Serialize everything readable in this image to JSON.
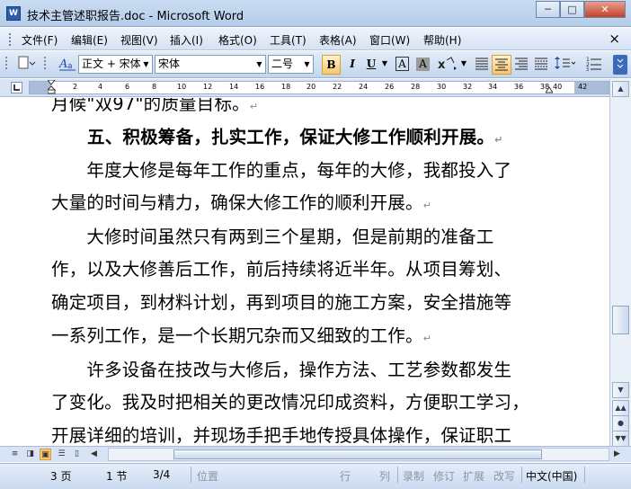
{
  "window": {
    "title": "技术主管述职报告.doc - Microsoft Word",
    "app_icon": "W",
    "controls": {
      "minimize": "─",
      "maximize": "□",
      "close": "✕"
    }
  },
  "menu": {
    "items": [
      "文件(F)",
      "编辑(E)",
      "视图(V)",
      "插入(I)",
      "格式(O)",
      "工具(T)",
      "表格(A)",
      "窗口(W)",
      "帮助(H)"
    ],
    "close_doc": "×"
  },
  "toolbar": {
    "style_value": "正文 + 宋体",
    "font_value": "宋体",
    "size_value": "二号",
    "bold": "B",
    "italic": "I",
    "underline": "U",
    "char_border": "A",
    "char_shading": "A",
    "font_color": "A",
    "highlight_color": "#f0c050",
    "accent": "#f7c56b"
  },
  "ruler": {
    "ticks": [
      "2",
      "4",
      "6",
      "8",
      "10",
      "12",
      "14",
      "16",
      "18",
      "20",
      "22",
      "24",
      "26",
      "28",
      "30",
      "32",
      "34",
      "36",
      "38",
      "40",
      "42"
    ]
  },
  "document": {
    "partial_line": "月候\"双97\"的质量目标。",
    "heading": "五、积极筹备，扎实工作，保证大修工作顺利开展。",
    "lines": [
      "　　年度大修是每年工作的重点，每年的大修，我都投入了",
      "大量的时间与精力，确保大修工作的顺利开展。",
      "　　大修时间虽然只有两到三个星期，但是前期的准备工",
      "作，以及大修善后工作，前后持续将近半年。从项目筹划、",
      "确定项目，到材料计划，再到项目的施工方案，安全措施等",
      "一系列工作，是一个长期冗杂而又细致的工作。",
      "　　许多设备在技改与大修后，操作方法、工艺参数都发生",
      "了变化。我及时把相关的更改情况印成资料，方便职工学习，",
      "开展详细的培训，并现场手把手地传授具体操作，保证职工"
    ],
    "paragraph_mark": "↵"
  },
  "statusbar": {
    "page": "3 页",
    "section": "1 节",
    "page_of": "3/4",
    "position": "位置",
    "line": "行",
    "column": "列",
    "rec": "录制",
    "trk": "修订",
    "ext": "扩展",
    "ovr": "改写",
    "language": "中文(中国)"
  }
}
